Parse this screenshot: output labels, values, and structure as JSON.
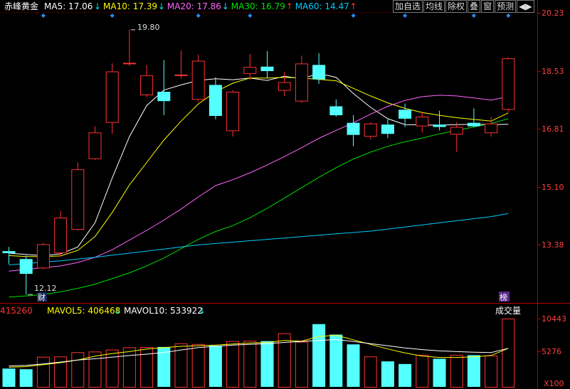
{
  "stock_name": "赤峰黄金",
  "ma_legend": [
    {
      "label": "MA5: 17.06",
      "arrow": "↓",
      "color": "#ffffff",
      "arrow_color": "#00e5e5"
    },
    {
      "label": "MA10: 17.39",
      "arrow": "↓",
      "color": "#ffff00",
      "arrow_color": "#00e5e5"
    },
    {
      "label": "MA20: 17.86",
      "arrow": "↓",
      "color": "#ff66ff",
      "arrow_color": "#00e5e5"
    },
    {
      "label": "MA30: 16.79",
      "arrow": "↑",
      "color": "#00e000",
      "arrow_color": "#ff3333"
    },
    {
      "label": "MA60: 14.47",
      "arrow": "↑",
      "color": "#00ccff",
      "arrow_color": "#ff3333"
    }
  ],
  "toolbar": {
    "buttons": [
      "加自选",
      "均线",
      "除权",
      "叠",
      "窗",
      "预测"
    ],
    "nav_label": "◀▶"
  },
  "price_axis_ticks": [
    "20.23",
    "18.53",
    "16.81",
    "15.10",
    "13.38"
  ],
  "annotations": {
    "high_label": "19.80",
    "low_label": "12.12",
    "cai_marker": "财",
    "bang_marker": "榜"
  },
  "volume_header": {
    "volume_value": "415260",
    "mavol5_label": "MAVOL5: 406468",
    "mavol5_arrow": "↓",
    "mavol10_label": "MAVOL10: 533922",
    "mavol10_arrow": "↓",
    "panel_title": "成交量"
  },
  "volume_axis_ticks": [
    "10443",
    "5276"
  ],
  "volume_unit": "X100",
  "colors": {
    "up": "#ff3232",
    "down": "#54ffff",
    "axis": "#b40000",
    "tick_text": "#ff4040",
    "diamond": "#1e90ff"
  },
  "chart_data": [
    {
      "type": "candlestick",
      "title": "赤峰黄金",
      "ylim": [
        12.0,
        20.25
      ],
      "candles": [
        {
          "o": 13.38,
          "h": 13.5,
          "l": 13.0,
          "c": 13.32
        },
        {
          "o": 13.15,
          "h": 13.25,
          "l": 12.12,
          "c": 12.72
        },
        {
          "o": 12.88,
          "h": 13.62,
          "l": 12.85,
          "c": 13.58
        },
        {
          "o": 13.32,
          "h": 14.55,
          "l": 13.22,
          "c": 14.35
        },
        {
          "o": 14.0,
          "h": 15.95,
          "l": 13.98,
          "c": 15.75
        },
        {
          "o": 16.05,
          "h": 17.0,
          "l": 16.02,
          "c": 16.82
        },
        {
          "o": 17.1,
          "h": 18.83,
          "l": 16.78,
          "c": 18.59
        },
        {
          "o": 18.8,
          "h": 19.8,
          "l": 18.75,
          "c": 18.84
        },
        {
          "o": 17.9,
          "h": 18.78,
          "l": 17.85,
          "c": 18.48
        },
        {
          "o": 18.0,
          "h": 18.92,
          "l": 17.32,
          "c": 17.73
        },
        {
          "o": 18.46,
          "h": 19.2,
          "l": 18.38,
          "c": 18.5
        },
        {
          "o": 17.77,
          "h": 19.08,
          "l": 17.72,
          "c": 18.9
        },
        {
          "o": 18.2,
          "h": 18.42,
          "l": 17.2,
          "c": 17.3
        },
        {
          "o": 16.86,
          "h": 18.05,
          "l": 16.7,
          "c": 18.0
        },
        {
          "o": 18.52,
          "h": 19.1,
          "l": 18.35,
          "c": 18.72
        },
        {
          "o": 18.73,
          "h": 19.18,
          "l": 18.38,
          "c": 18.6
        },
        {
          "o": 18.03,
          "h": 18.58,
          "l": 17.88,
          "c": 18.28
        },
        {
          "o": 17.72,
          "h": 19.05,
          "l": 17.68,
          "c": 18.82
        },
        {
          "o": 18.78,
          "h": 19.12,
          "l": 18.23,
          "c": 18.36
        },
        {
          "o": 17.58,
          "h": 17.78,
          "l": 17.28,
          "c": 17.32
        },
        {
          "o": 17.1,
          "h": 17.32,
          "l": 16.42,
          "c": 16.75
        },
        {
          "o": 16.7,
          "h": 17.12,
          "l": 16.62,
          "c": 17.08
        },
        {
          "o": 17.05,
          "h": 17.2,
          "l": 16.66,
          "c": 16.78
        },
        {
          "o": 17.48,
          "h": 17.66,
          "l": 16.98,
          "c": 17.22
        },
        {
          "o": 17.0,
          "h": 17.42,
          "l": 16.82,
          "c": 17.28
        },
        {
          "o": 17.05,
          "h": 17.45,
          "l": 16.88,
          "c": 16.98
        },
        {
          "o": 16.76,
          "h": 17.12,
          "l": 16.26,
          "c": 16.98
        },
        {
          "o": 17.1,
          "h": 17.52,
          "l": 16.98,
          "c": 17.0
        },
        {
          "o": 16.8,
          "h": 17.28,
          "l": 16.7,
          "c": 17.08
        },
        {
          "o": 17.48,
          "h": 19.0,
          "l": 17.42,
          "c": 18.97
        }
      ],
      "series": [
        {
          "name": "MA5",
          "color": "#ffffff",
          "values": [
            13.32,
            13.28,
            13.25,
            13.3,
            13.5,
            14.2,
            15.5,
            16.7,
            17.6,
            18.05,
            18.2,
            18.33,
            18.38,
            18.35,
            18.4,
            18.33,
            18.45,
            18.38,
            18.53,
            18.42,
            17.95,
            17.55,
            17.22,
            17.05,
            17.04,
            17.03,
            17.05,
            17.06,
            17.05,
            17.06
          ]
        },
        {
          "name": "MA10",
          "color": "#ffff00",
          "values": [
            13.25,
            13.22,
            13.22,
            13.24,
            13.4,
            13.8,
            14.5,
            15.3,
            15.95,
            16.6,
            17.15,
            17.65,
            18.0,
            18.25,
            18.4,
            18.4,
            18.42,
            18.4,
            18.36,
            18.32,
            18.1,
            17.88,
            17.68,
            17.52,
            17.4,
            17.32,
            17.25,
            17.2,
            17.15,
            17.39
          ]
        },
        {
          "name": "MA20",
          "color": "#ff66ff",
          "values": [
            12.8,
            12.85,
            12.9,
            12.95,
            13.05,
            13.2,
            13.42,
            13.7,
            13.98,
            14.28,
            14.6,
            14.95,
            15.28,
            15.45,
            15.65,
            15.88,
            16.12,
            16.38,
            16.65,
            16.88,
            17.1,
            17.35,
            17.58,
            17.75,
            17.86,
            17.9,
            17.88,
            17.82,
            17.76,
            17.86
          ]
        },
        {
          "name": "MA30",
          "color": "#00e000",
          "values": [
            12.05,
            12.08,
            12.12,
            12.2,
            12.3,
            12.42,
            12.58,
            12.75,
            12.95,
            13.18,
            13.45,
            13.72,
            13.95,
            14.12,
            14.35,
            14.62,
            14.92,
            15.22,
            15.52,
            15.8,
            16.05,
            16.25,
            16.42,
            16.55,
            16.66,
            16.78,
            16.88,
            16.98,
            17.08,
            17.22
          ]
        },
        {
          "name": "MA60",
          "color": "#00ccff",
          "values": [
            12.98,
            13.02,
            13.06,
            13.1,
            13.15,
            13.2,
            13.26,
            13.32,
            13.38,
            13.44,
            13.5,
            13.56,
            13.6,
            13.64,
            13.68,
            13.72,
            13.76,
            13.8,
            13.84,
            13.88,
            13.92,
            13.96,
            14.02,
            14.08,
            14.14,
            14.2,
            14.26,
            14.32,
            14.38,
            14.47
          ]
        }
      ]
    },
    {
      "type": "bar",
      "title": "成交量",
      "ylim": [
        0,
        10443
      ],
      "values": [
        2800,
        2700,
        4600,
        4650,
        5300,
        5400,
        5700,
        6050,
        6100,
        6100,
        6650,
        6550,
        6300,
        7000,
        7050,
        7000,
        8200,
        6900,
        9600,
        8000,
        6500,
        4650,
        3900,
        3500,
        4900,
        4300,
        4900,
        4850,
        4800,
        10443
      ],
      "series": [
        {
          "name": "MAVOL5",
          "color": "#ffff00",
          "values": [
            3000,
            3100,
            3400,
            3700,
            4100,
            4700,
            5100,
            5400,
            5800,
            6000,
            6200,
            6300,
            6400,
            6550,
            6700,
            6800,
            7100,
            7000,
            7700,
            7900,
            7200,
            6500,
            5800,
            5200,
            4700,
            4500,
            4500,
            4600,
            4800,
            5900
          ]
        },
        {
          "name": "MAVOL10",
          "color": "#ffffff",
          "values": [
            3200,
            3300,
            3500,
            3800,
            4100,
            4300,
            4550,
            4800,
            5000,
            5250,
            5650,
            6000,
            6200,
            6400,
            6500,
            6600,
            6800,
            6950,
            7100,
            7250,
            6950,
            6600,
            6300,
            5950,
            5700,
            5500,
            5400,
            5300,
            5250,
            5900
          ]
        }
      ]
    }
  ]
}
